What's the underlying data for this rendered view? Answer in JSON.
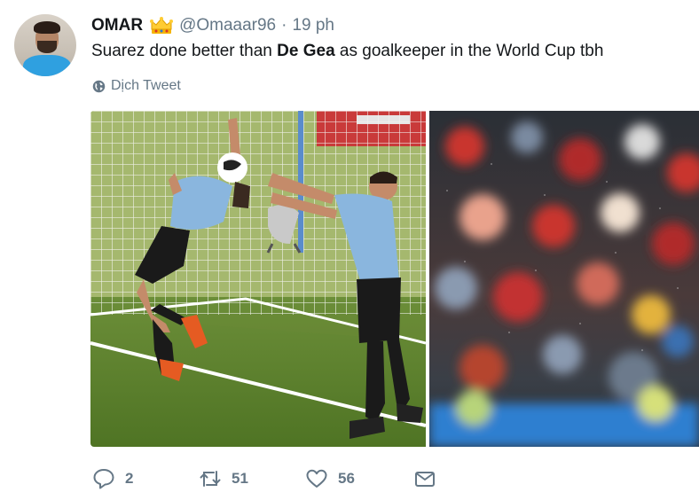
{
  "tweet": {
    "display_name": "OMAR",
    "handle": "@Omaaar96",
    "separator": "·",
    "time": "19 ph",
    "text_before": "Suarez done better than ",
    "text_bold": "De Gea",
    "text_after": " as goalkeeper in the World Cup tbh",
    "translate_label": "Dịch Tweet"
  },
  "icons": {
    "avatar": "user-avatar",
    "badge": "crown-icon",
    "translate": "globe-icon",
    "reply": "reply-icon",
    "retweet": "retweet-icon",
    "like": "heart-icon",
    "dm": "envelope-icon"
  },
  "actions": {
    "reply_count": "2",
    "retweet_count": "51",
    "like_count": "56"
  },
  "colors": {
    "text": "#14171a",
    "secondary": "#657786",
    "crown": "#f5b400"
  }
}
